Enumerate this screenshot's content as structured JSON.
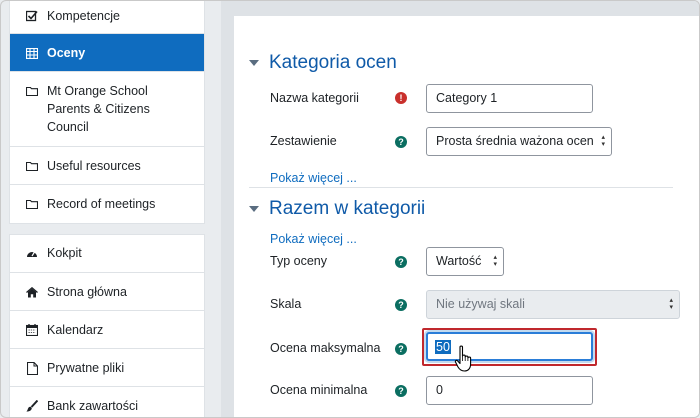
{
  "sidebar": {
    "group1": [
      {
        "label": "Kompetencje",
        "icon": "checkbox-icon",
        "active": false
      },
      {
        "label": "Oceny",
        "icon": "table-icon",
        "active": true
      },
      {
        "label": "Mt Orange School Parents & Citizens Council",
        "icon": "folder-icon",
        "active": false
      },
      {
        "label": "Useful resources",
        "icon": "folder-icon",
        "active": false
      },
      {
        "label": "Record of meetings",
        "icon": "folder-icon",
        "active": false
      }
    ],
    "group2": [
      {
        "label": "Kokpit",
        "icon": "dashboard-icon"
      },
      {
        "label": "Strona główna",
        "icon": "home-icon"
      },
      {
        "label": "Kalendarz",
        "icon": "calendar-icon"
      },
      {
        "label": "Prywatne pliki",
        "icon": "file-icon"
      },
      {
        "label": "Bank zawartości",
        "icon": "paintbrush-icon"
      }
    ]
  },
  "main": {
    "section1": {
      "title": "Kategoria ocen",
      "name_label": "Nazwa kategorii",
      "name_value": "Category 1",
      "aggregation_label": "Zestawienie",
      "aggregation_value": "Prosta średnia ważona ocen",
      "show_more": "Pokaż więcej ..."
    },
    "section2": {
      "title": "Razem w kategorii",
      "show_more": "Pokaż więcej ...",
      "grade_type_label": "Typ oceny",
      "grade_type_value": "Wartość",
      "scale_label": "Skala",
      "scale_value": "Nie używaj skali",
      "max_grade_label": "Ocena maksymalna",
      "max_grade_value": "50",
      "min_grade_label": "Ocena minimalna",
      "min_grade_value": "0"
    }
  },
  "colors": {
    "accent": "#0f6cbf",
    "heading": "#0f5aa8",
    "help": "#0b6e61",
    "required": "#c9302c",
    "highlight": "#c0282d"
  }
}
